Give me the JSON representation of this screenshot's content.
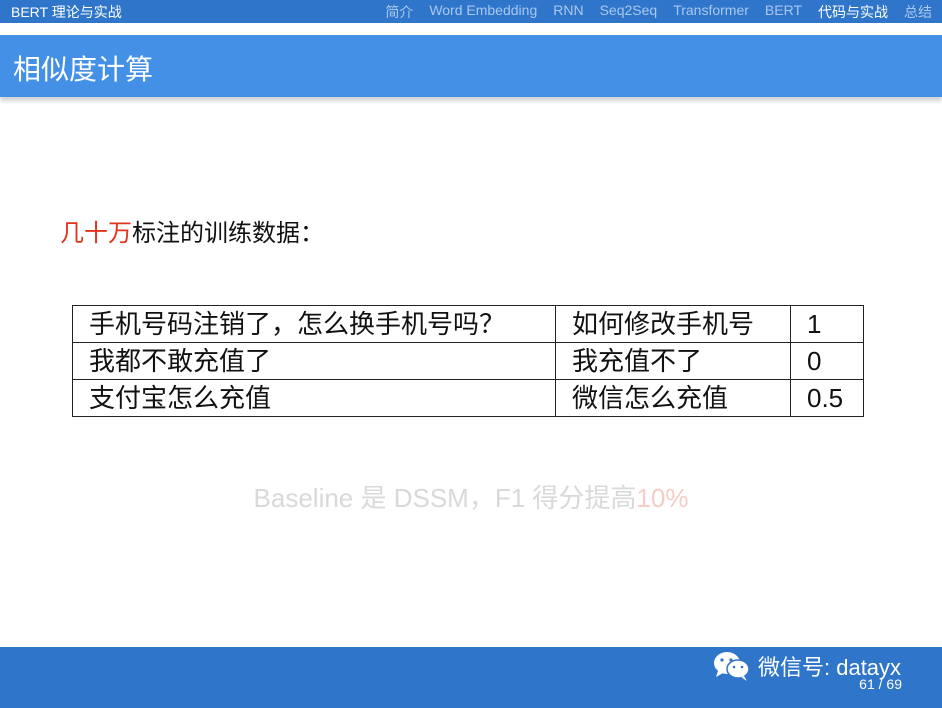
{
  "topbar": {
    "doc_title": "BERT 理论与实战",
    "nav": [
      {
        "label": "简介",
        "active": false
      },
      {
        "label": "Word Embedding",
        "active": false
      },
      {
        "label": "RNN",
        "active": false
      },
      {
        "label": "Seq2Seq",
        "active": false
      },
      {
        "label": "Transformer",
        "active": false
      },
      {
        "label": "BERT",
        "active": false
      },
      {
        "label": "代码与实战",
        "active": true
      },
      {
        "label": "总结",
        "active": false
      }
    ]
  },
  "slide": {
    "title": "相似度计算",
    "heading_highlight": "几十万",
    "heading_rest": "标注的训练数据：",
    "rows": [
      {
        "q1": "手机号码注销了，怎么换手机号吗？",
        "q2": "如何修改手机号",
        "score": "1"
      },
      {
        "q1": "我都不敢充值了",
        "q2": "我充值不了",
        "score": "0"
      },
      {
        "q1": "支付宝怎么充值",
        "q2": "微信怎么充值",
        "score": "0.5"
      }
    ],
    "baseline_text": "Baseline 是 DSSM，F1 得分提高",
    "baseline_pct": "10%"
  },
  "footer": {
    "watermark": "微信号: datayx",
    "page": "61 / 69"
  },
  "colors": {
    "topbar": "#2f75c9",
    "titlebar": "#4590e7",
    "highlight": "#e0341c"
  },
  "icons": {
    "wechat": "wechat-icon"
  }
}
